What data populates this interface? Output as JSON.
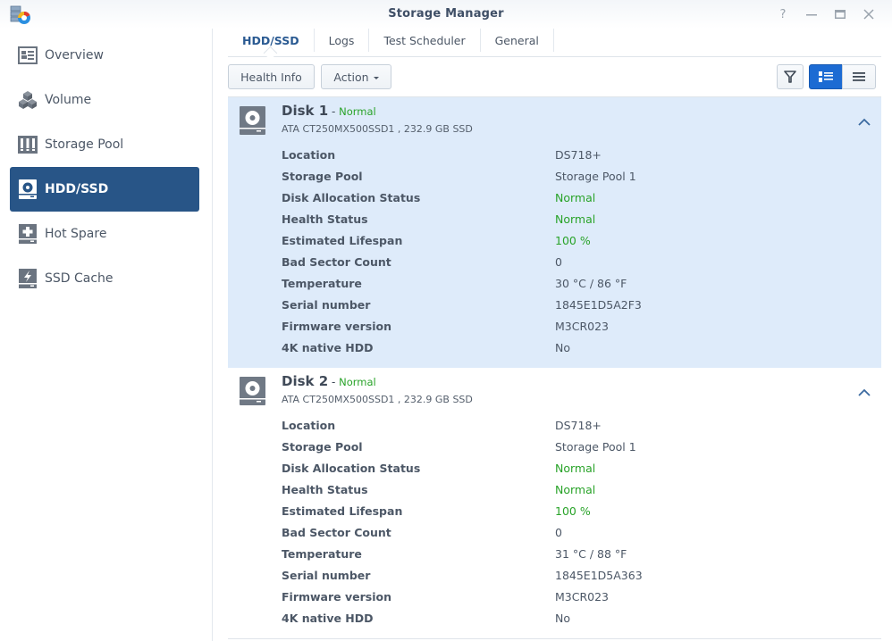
{
  "window": {
    "title": "Storage Manager",
    "controls": [
      "help",
      "minimize",
      "maximize",
      "close"
    ]
  },
  "sidebar": {
    "items": [
      {
        "label": "Overview",
        "icon": "overview-icon",
        "active": false
      },
      {
        "label": "Volume",
        "icon": "volume-icon",
        "active": false
      },
      {
        "label": "Storage Pool",
        "icon": "storage-pool-icon",
        "active": false
      },
      {
        "label": "HDD/SSD",
        "icon": "hdd-icon",
        "active": true
      },
      {
        "label": "Hot Spare",
        "icon": "hot-spare-icon",
        "active": false
      },
      {
        "label": "SSD Cache",
        "icon": "ssd-cache-icon",
        "active": false
      }
    ]
  },
  "tabs": [
    {
      "label": "HDD/SSD",
      "active": true
    },
    {
      "label": "Logs",
      "active": false
    },
    {
      "label": "Test Scheduler",
      "active": false
    },
    {
      "label": "General",
      "active": false
    }
  ],
  "toolbar": {
    "health_info_label": "Health Info",
    "action_label": "Action",
    "view_mode": "detail"
  },
  "colors": {
    "accent": "#285587",
    "selected_row": "#deebfa",
    "status_green": "#29a329",
    "view_toggle_active": "#1c6bd3"
  },
  "disks": [
    {
      "name": "Disk 1",
      "separator": " - ",
      "status": "Normal",
      "model": "ATA CT250MX500SSD1 , 232.9 GB SSD",
      "selected": true,
      "details": [
        {
          "key": "Location",
          "value": "DS718+",
          "green": false
        },
        {
          "key": "Storage Pool",
          "value": "Storage Pool 1",
          "green": false
        },
        {
          "key": "Disk Allocation Status",
          "value": "Normal",
          "green": true
        },
        {
          "key": "Health Status",
          "value": "Normal",
          "green": true
        },
        {
          "key": "Estimated Lifespan",
          "value": "100 %",
          "green": true
        },
        {
          "key": "Bad Sector Count",
          "value": "0",
          "green": false
        },
        {
          "key": "Temperature",
          "value": "30 °C / 86 °F",
          "green": false
        },
        {
          "key": "Serial number",
          "value": "1845E1D5A2F3",
          "green": false
        },
        {
          "key": "Firmware version",
          "value": "M3CR023",
          "green": false
        },
        {
          "key": "4K native HDD",
          "value": "No",
          "green": false
        }
      ]
    },
    {
      "name": "Disk 2",
      "separator": " - ",
      "status": "Normal",
      "model": "ATA CT250MX500SSD1 , 232.9 GB SSD",
      "selected": false,
      "details": [
        {
          "key": "Location",
          "value": "DS718+",
          "green": false
        },
        {
          "key": "Storage Pool",
          "value": "Storage Pool 1",
          "green": false
        },
        {
          "key": "Disk Allocation Status",
          "value": "Normal",
          "green": true
        },
        {
          "key": "Health Status",
          "value": "Normal",
          "green": true
        },
        {
          "key": "Estimated Lifespan",
          "value": "100 %",
          "green": true
        },
        {
          "key": "Bad Sector Count",
          "value": "0",
          "green": false
        },
        {
          "key": "Temperature",
          "value": "31 °C / 88 °F",
          "green": false
        },
        {
          "key": "Serial number",
          "value": "1845E1D5A363",
          "green": false
        },
        {
          "key": "Firmware version",
          "value": "M3CR023",
          "green": false
        },
        {
          "key": "4K native HDD",
          "value": "No",
          "green": false
        }
      ]
    }
  ]
}
